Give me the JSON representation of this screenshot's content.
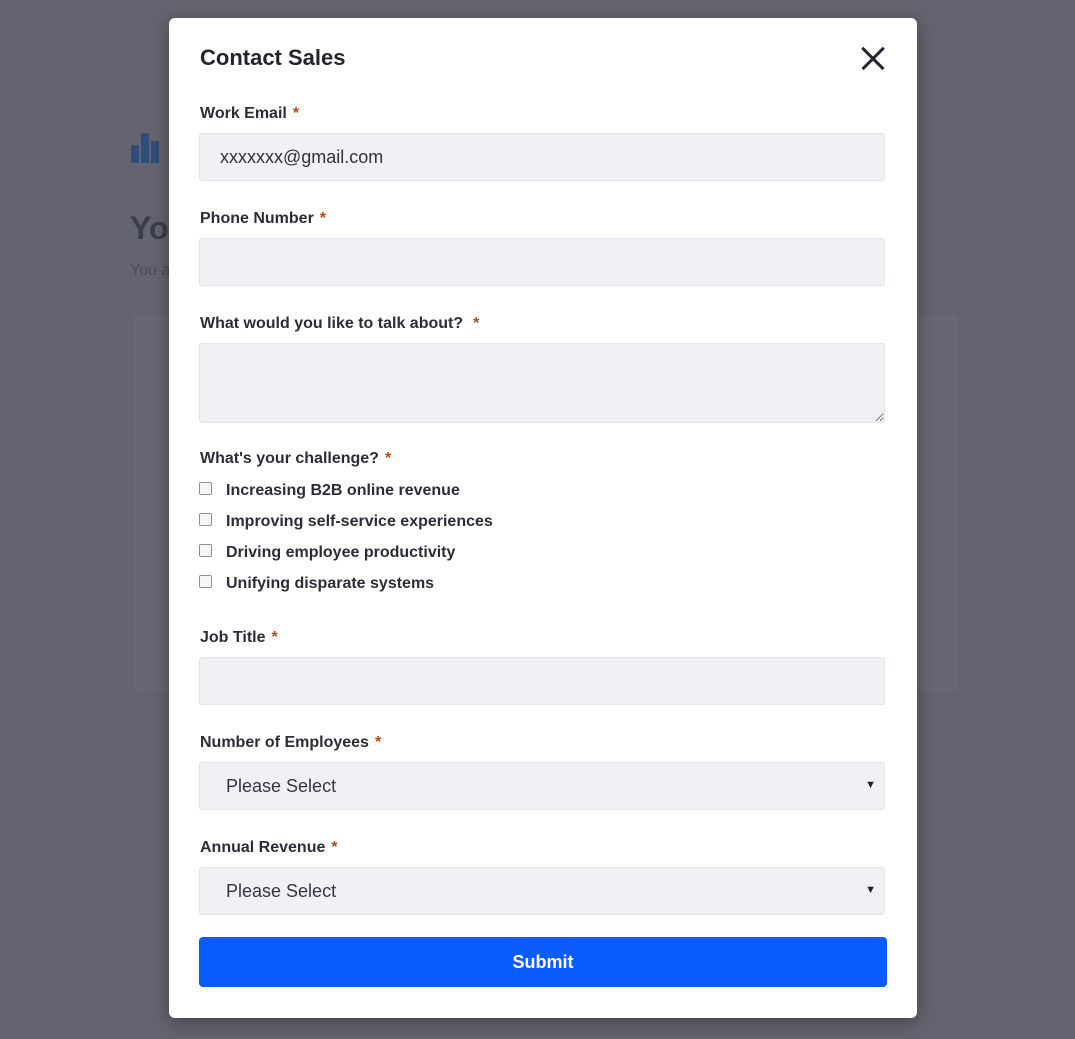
{
  "background": {
    "heading_fragment": "Yo",
    "sub_fragment": "You a"
  },
  "modal": {
    "title": "Contact Sales",
    "close_icon": "close-icon"
  },
  "form": {
    "required_marker": "*",
    "work_email": {
      "label": "Work Email",
      "value": "xxxxxxx@gmail.com"
    },
    "phone_number": {
      "label": "Phone Number",
      "value": ""
    },
    "talk_about": {
      "label": "What would you like to talk about?",
      "value": ""
    },
    "challenge": {
      "label": "What's your challenge?",
      "options": [
        "Increasing B2B online revenue",
        "Improving self-service experiences",
        "Driving employee productivity",
        "Unifying disparate systems"
      ]
    },
    "job_title": {
      "label": "Job Title",
      "value": ""
    },
    "employees": {
      "label": "Number of Employees",
      "selected": "Please Select"
    },
    "revenue": {
      "label": "Annual Revenue",
      "selected": "Please Select"
    },
    "submit_label": "Submit"
  },
  "colors": {
    "overlay": "#63646f",
    "accent": "#0b5cff",
    "required": "#c0480f",
    "field_bg": "#f0f1f5"
  }
}
